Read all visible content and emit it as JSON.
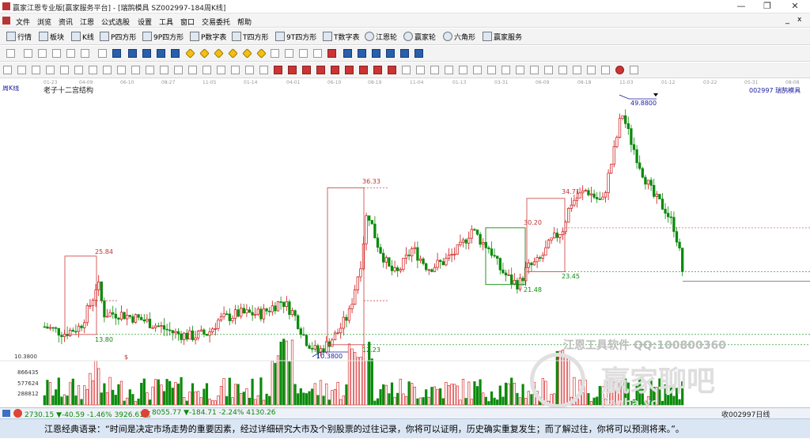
{
  "window": {
    "title": "赢家江恩专业版[赢家服务平台] - [瑞鹄模具 SZ002997-184周K线]",
    "min_glyph": "—",
    "max_glyph": "❐",
    "close_glyph": "✕"
  },
  "menus": [
    "文件",
    "浏览",
    "资讯",
    "江恩",
    "公式选股",
    "设置",
    "工具",
    "窗口",
    "交易委托",
    "帮助"
  ],
  "toolbar": [
    "行情",
    "板块",
    "K线",
    "P四方形",
    "9P四方形",
    "P数字表",
    "T四方形",
    "9T四方形",
    "T数字表",
    "江恩轮",
    "赢家轮",
    "六角形",
    "赢家服务"
  ],
  "chart": {
    "period_label": "周K线",
    "structure_label": "老子十二宫结构",
    "stock_label": "002997 瑞鹄模具",
    "date_ticks": [
      "01-23",
      "04-09",
      "06-10",
      "08-27",
      "11-05",
      "01-14",
      "04-01",
      "06-10",
      "08-19",
      "11-04",
      "01-13",
      "03-31",
      "06-09",
      "08-18",
      "11-03",
      "01-12",
      "03-22",
      "05-31",
      "08-08"
    ],
    "price_labels": [
      "49.8800",
      "36.33",
      "34.71",
      "30.20",
      "25.84",
      "23.45",
      "21.48",
      "13.80",
      "12.23",
      "10.3800"
    ],
    "volume_ticks": [
      "10.3800",
      "866435",
      "577624",
      "288812"
    ],
    "dollar_marks": [
      "$",
      "$"
    ],
    "accent_colors": {
      "up": "#d11010",
      "down": "#0a8a0a",
      "box": "#d05050",
      "ann": "#1a1aa0"
    }
  },
  "chart_data": {
    "type": "candlestick",
    "title": "老子十二宫结构",
    "price_levels": [
      49.88,
      36.33,
      34.71,
      30.2,
      25.84,
      23.45,
      21.48,
      13.8,
      12.23,
      10.38
    ],
    "volume_axis": [
      866435,
      577624,
      288812
    ]
  },
  "watermark": {
    "line1": "江恩工具软件 QQ:100800360",
    "line2": "赢家聊吧",
    "line3": "jiaoba.yc"
  },
  "status": {
    "sh": "2730.15 ▼-40.59 -1.46% 3926.61亿",
    "sz": "8055.77 ▼-184.71 -2.24% 4130.26",
    "right": "收002997日线"
  },
  "quote": "江恩经典语录：“时间是决定市场走势的重要因素，经过详细研究大市及个别股票的过往记录，你将可以证明，历史确实重复发生；而了解过往，你将可以预测将来。”。"
}
